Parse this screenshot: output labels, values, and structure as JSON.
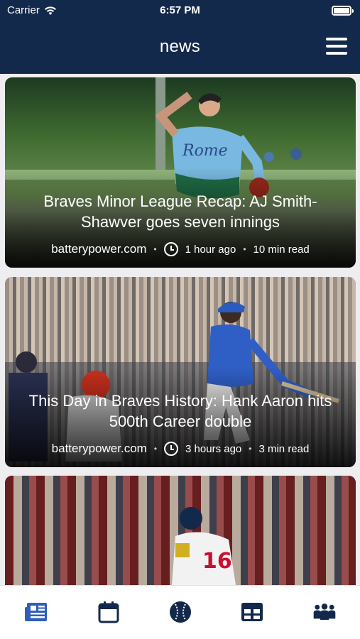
{
  "status_bar": {
    "carrier": "Carrier",
    "time": "6:57 PM"
  },
  "header": {
    "title": "news"
  },
  "articles": [
    {
      "headline": "Braves Minor League Recap: AJ Smith-Shawver goes seven innings",
      "source": "batterypower.com",
      "time_ago": "1 hour ago",
      "read_time": "10 min read"
    },
    {
      "headline": "This Day in Braves History: Hank Aaron hits 500th Career double",
      "source": "batterypower.com",
      "time_ago": "3 hours ago",
      "read_time": "3 min read"
    },
    {
      "headline": "",
      "source": "",
      "time_ago": "",
      "read_time": ""
    }
  ],
  "tabbar": {
    "tabs": [
      {
        "icon": "newspaper-icon",
        "active": true
      },
      {
        "icon": "calendar-icon",
        "active": false
      },
      {
        "icon": "baseball-icon",
        "active": false
      },
      {
        "icon": "table-grid-icon",
        "active": false
      },
      {
        "icon": "team-people-icon",
        "active": false
      }
    ]
  },
  "colors": {
    "navy": "#13294b",
    "active_tab": "#2f5fb8",
    "inactive_tab": "#13294b"
  }
}
